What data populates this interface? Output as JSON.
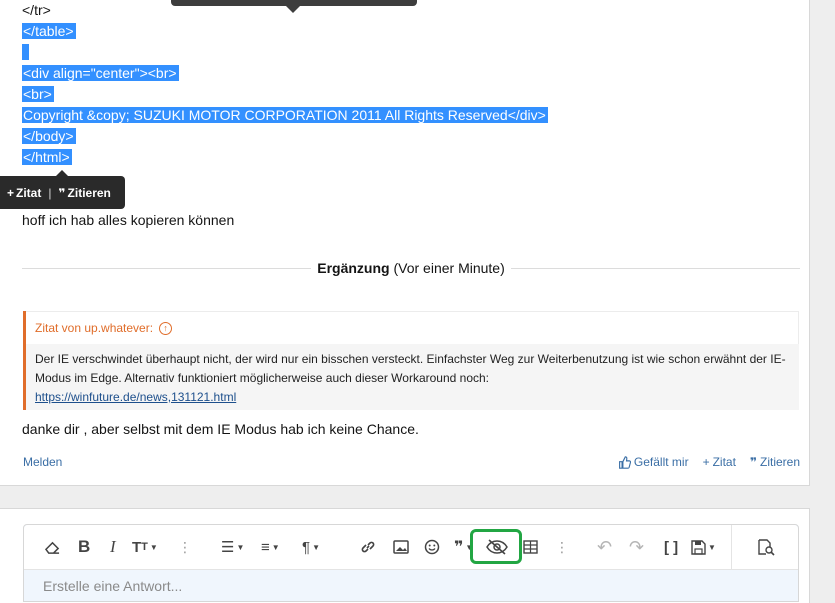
{
  "code_lines": [
    {
      "text": "</tr>",
      "selected": false
    },
    {
      "text": "</table>",
      "selected": true
    },
    {
      "text": " ",
      "selected": true
    },
    {
      "text": "<div align=\"center\"><br>",
      "selected": true
    },
    {
      "text": "<br>",
      "selected": true
    },
    {
      "text": "Copyright &copy; SUZUKI MOTOR CORPORATION 2011 All Rights Reserved</div>",
      "selected": true
    },
    {
      "text": "</body>",
      "selected": true
    },
    {
      "text": "</html>",
      "selected": true
    }
  ],
  "quote_toolbar": {
    "zitat": "Zitat",
    "separator": "|",
    "zitieren": "Zitieren"
  },
  "post": {
    "text1": "hoff ich hab alles kopieren können",
    "addition_label": "Ergänzung",
    "addition_time": "(Vor einer Minute)",
    "quote": {
      "author": "Zitat von up.whatever:",
      "body": "Der IE verschwindet überhaupt nicht, der wird nur ein bisschen versteckt. Einfachster Weg zur Weiterbenutzung ist wie schon erwähnt der IE-Modus im Edge. Alternativ funktioniert möglicherweise auch dieser Workaround noch:",
      "link": "https://winfuture.de/news,131121.html"
    },
    "text2": "danke dir , aber selbst mit dem IE Modus hab ich keine Chance.",
    "actions": {
      "report": "Melden",
      "like": "Gefällt mir",
      "quote": "Zitat",
      "cite": "Zitieren"
    }
  },
  "editor": {
    "placeholder": "Erstelle eine Antwort...",
    "toolbar_icons": [
      "eraser-icon",
      "bold-icon",
      "italic-icon",
      "text-size-icon",
      "list-icon",
      "align-icon",
      "paragraph-icon",
      "link-icon",
      "image-icon",
      "smiley-icon",
      "quote-icon",
      "hide-content-icon",
      "table-icon",
      "undo-icon",
      "redo-icon",
      "bbcode-icon",
      "drafts-icon",
      "preview-icon"
    ]
  },
  "colors": {
    "selection": "#3390ff",
    "quote_accent": "#e06d2a",
    "link": "#3a6ea5",
    "highlight": "#22a643",
    "editor_bg": "#f0f6fd"
  }
}
